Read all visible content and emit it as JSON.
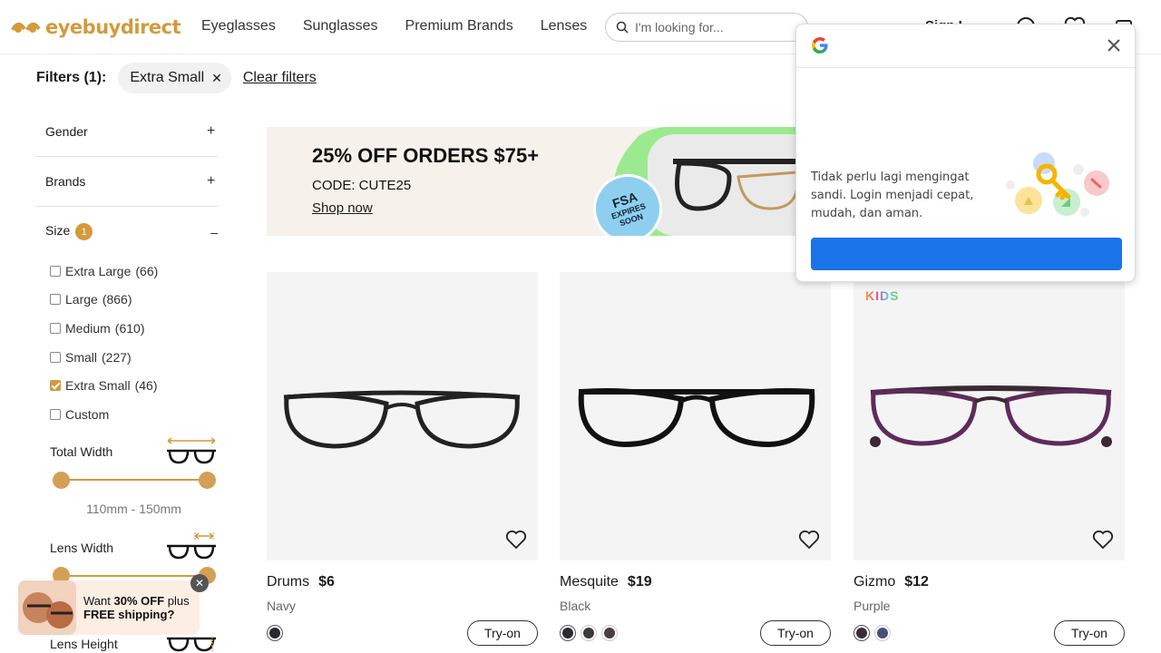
{
  "header": {
    "logo_text": "eyebuydirect",
    "nav": [
      "Eyeglasses",
      "Sunglasses",
      "Premium Brands",
      "Lenses"
    ],
    "search_placeholder": "I'm looking for...",
    "partial_text": "Sign I"
  },
  "filters": {
    "label": "Filters (1):",
    "chip": "Extra Small",
    "clear": "Clear filters"
  },
  "sidebar": {
    "gender": "Gender",
    "brands": "Brands",
    "size": "Size",
    "size_badge": "1",
    "sizes": [
      {
        "label": "Extra Large",
        "count": "(66)",
        "checked": false
      },
      {
        "label": "Large",
        "count": "(866)",
        "checked": false
      },
      {
        "label": "Medium",
        "count": "(610)",
        "checked": false
      },
      {
        "label": "Small",
        "count": "(227)",
        "checked": false
      },
      {
        "label": "Extra Small",
        "count": "(46)",
        "checked": true
      },
      {
        "label": "Custom",
        "count": "",
        "checked": false
      }
    ],
    "total_width": {
      "title": "Total Width",
      "value": "110mm - 150mm"
    },
    "lens_width": {
      "title": "Lens Width"
    },
    "lens_height": {
      "title": "Lens Height"
    }
  },
  "promo_popup": {
    "line1_prefix": "Want ",
    "line1_bold": "30% OFF",
    "line1_suffix": " plus",
    "line2": "FREE shipping?"
  },
  "banner": {
    "headline": "25% OFF ORDERS $75+",
    "code": "CODE: CUTE25",
    "shop": "Shop now",
    "fsa_title": "FSA",
    "fsa_line1": "EXPIRES",
    "fsa_line2": "SOON"
  },
  "products": [
    {
      "name": "Drums",
      "price": "$6",
      "color": "Navy",
      "swatches": [
        "#2a2a2e"
      ],
      "tryon": "Try-on",
      "tag": ""
    },
    {
      "name": "Mesquite",
      "price": "$19",
      "color": "Black",
      "swatches": [
        "#2b2b2f",
        "#3a3a3c",
        "#4a3e3e"
      ],
      "tryon": "Try-on",
      "tag": ""
    },
    {
      "name": "Gizmo",
      "price": "$12",
      "color": "Purple",
      "swatches": [
        "#3a2c36",
        "#48507a"
      ],
      "tryon": "Try-on",
      "tag": "KIDS"
    }
  ],
  "google_popup": {
    "message": "Tidak perlu lagi mengingat sandi. Login menjadi cepat, mudah, dan aman."
  },
  "colors": {
    "brand": "#d49a3c",
    "google_blue": "#1a73e8"
  }
}
